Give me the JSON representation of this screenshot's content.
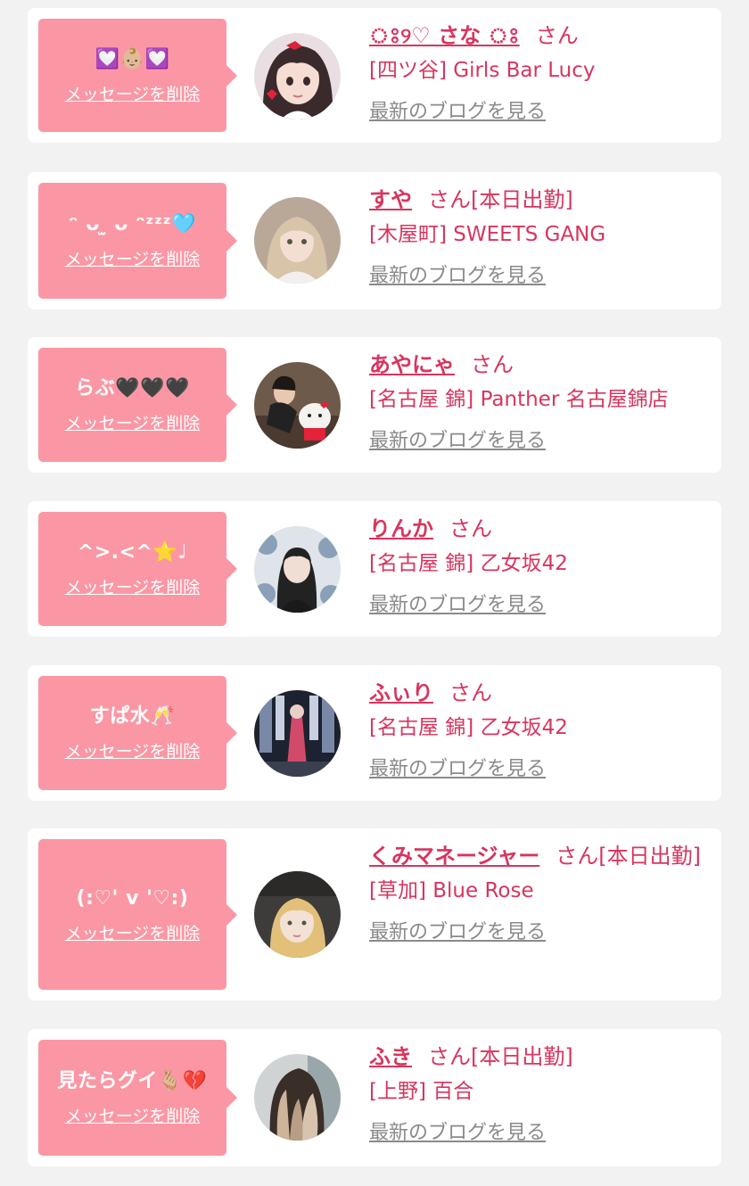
{
  "delete_label": "メッセージを削除",
  "blog_label": "最新のブログを見る",
  "san_suffix": "さん",
  "colors": {
    "background": "#f2f2f3",
    "bubble": "#fb97a4",
    "name": "#d8355e",
    "blog_link": "#8a8a8a"
  },
  "items": [
    {
      "message": "💟👶🏼💟",
      "name": "ঃ୨♡ さな ঃ",
      "suffix": "さん",
      "shop": "[四ツ谷] Girls Bar Lucy",
      "avatar_icon": "anime-girl-avatar"
    },
    {
      "message": "ᵔ ᴗ ̫ ᴗ ᵔᶻᶻᶻ🩵",
      "name": "すや",
      "suffix": "さん[本日出勤]",
      "shop": "[木屋町] SWEETS GANG",
      "avatar_icon": "girl-photo-avatar"
    },
    {
      "message": "らぶ🖤🖤🖤",
      "name": "あやにゃ",
      "suffix": "さん",
      "shop": "[名古屋 錦] Panther 名古屋錦店",
      "avatar_icon": "girl-with-plush-avatar"
    },
    {
      "message": "^>.<^⭐️♩",
      "name": "りんか",
      "suffix": "さん",
      "shop": "[名古屋 錦] 乙女坂42",
      "avatar_icon": "girl-photo-avatar"
    },
    {
      "message": "すぱ水🥂",
      "name": "ふぃり",
      "suffix": "さん",
      "shop": "[名古屋 錦] 乙女坂42",
      "avatar_icon": "girl-photo-avatar"
    },
    {
      "message": "(:♡' v '♡:)",
      "name": "くみマネージャー",
      "suffix": "さん[本日出勤]",
      "shop": "[草加] Blue Rose",
      "avatar_icon": "girl-photo-avatar"
    },
    {
      "message": "見たらグイ🫰🏼💔",
      "name": "ふき",
      "suffix": "さん[本日出勤]",
      "shop": "[上野] 百合",
      "avatar_icon": "hair-photo-avatar"
    }
  ]
}
